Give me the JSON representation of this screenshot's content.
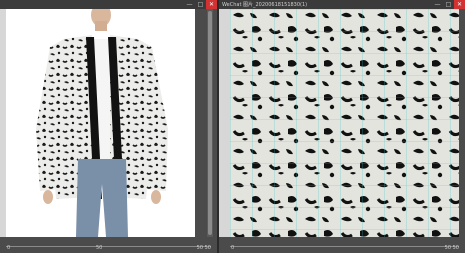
{
  "left_window": {
    "buttons": {
      "minimize": "—",
      "maximize": "□",
      "close": "✕"
    },
    "status_left": "0",
    "status_mid": "50",
    "status_right": "50 50"
  },
  "right_window": {
    "title": "WeChat 图片_20200618151830(1)",
    "buttons": {
      "minimize": "—",
      "maximize": "□",
      "close": "✕"
    },
    "status_left": "0",
    "status_right": "50 50"
  },
  "colors": {
    "frame": "#4b4b4b",
    "titlebar": "#3b3b3b",
    "close": "#d23232",
    "grid": "#37c6c6"
  },
  "icons": [
    "minimize-icon",
    "maximize-icon",
    "close-icon"
  ]
}
